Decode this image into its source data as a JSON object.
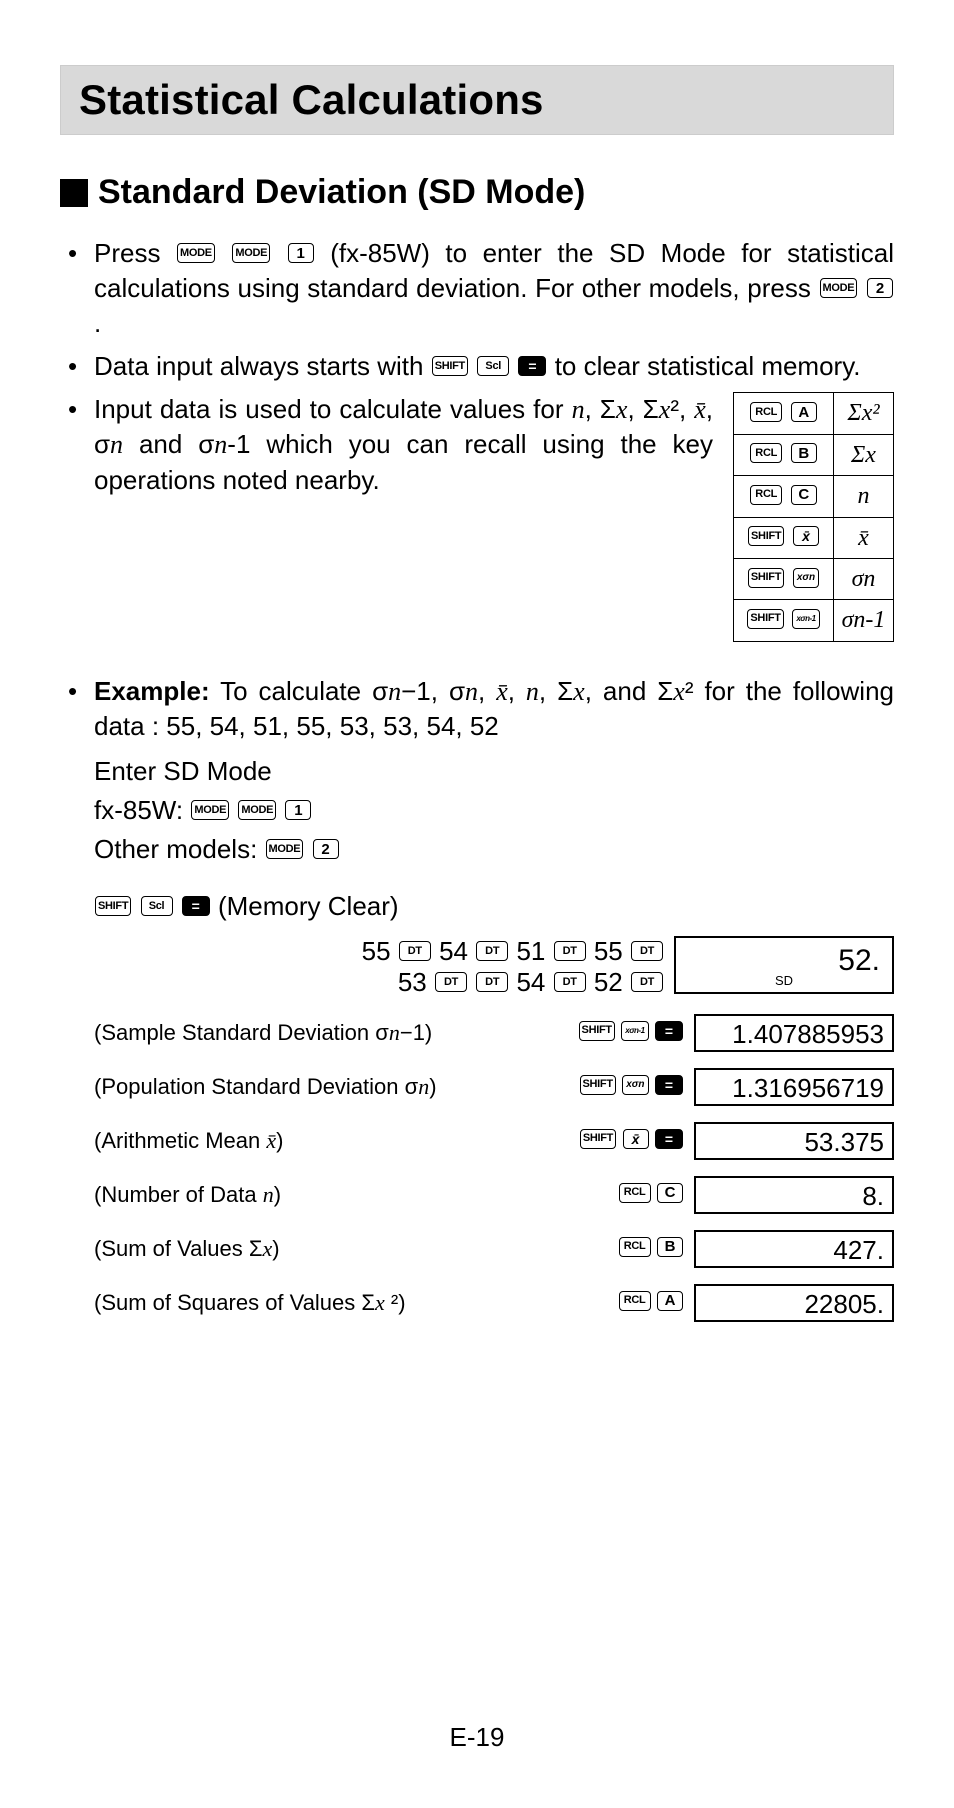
{
  "title": "Statistical Calculations",
  "section_heading": "Standard Deviation (SD Mode)",
  "bullets": {
    "b1_pre": "Press ",
    "b1_post_keys": " (fx-85W) to enter the SD Mode for statistical calculations using standard deviation. For other models, press ",
    "b1_end": ".",
    "b2_pre": "Data input always starts with ",
    "b2_post": " to clear statistical memory.",
    "b3": "Input data is used to calculate values for n, Σx, Σx², x̄, σn and σn-1 which you can recall using the key operations noted nearby."
  },
  "keys": {
    "mode": "MODE",
    "one": "1",
    "two": "2",
    "shift": "SHIFT",
    "scl": "Scl",
    "exe": "=",
    "rcl": "RCL",
    "A": "A",
    "B": "B",
    "C": "C",
    "DT": "DT"
  },
  "recall_table": [
    {
      "k1": "RCL",
      "k2": "A",
      "stat": "Σx²"
    },
    {
      "k1": "RCL",
      "k2": "B",
      "stat": "Σx"
    },
    {
      "k1": "RCL",
      "k2": "C",
      "stat": "n"
    },
    {
      "k1": "SHIFT",
      "k2": "x̄",
      "stat": "x̄"
    },
    {
      "k1": "SHIFT",
      "k2": "xσn",
      "stat": "σn"
    },
    {
      "k1": "SHIFT",
      "k2": "xσn-1",
      "stat": "σn-1"
    }
  ],
  "example": {
    "label": "Example:",
    "text_pre": " To calculate σn−1, σn, x̄, n, Σx, and Σx² for the following data : 55, 54, 51, 55, 53, 53, 54, 52",
    "enter_sd": "Enter SD Mode",
    "fx85w": "fx-85W: ",
    "other": "Other models: ",
    "mem_clear": " (Memory Clear)",
    "data_line1_vals": [
      "55",
      "54",
      "51",
      "55"
    ],
    "data_line2_vals": [
      "53",
      "",
      "54",
      "52"
    ],
    "first_display": "52.",
    "sd_tag": "SD"
  },
  "results": [
    {
      "label": "(Sample Standard Deviation σn−1)",
      "keys": "SHIFT xσn-1 =",
      "value": "1.407885953"
    },
    {
      "label": "(Population Standard Deviation σn)",
      "keys": "SHIFT xσn =",
      "value": "1.316956719"
    },
    {
      "label": "(Arithmetic Mean x̄)",
      "keys": "SHIFT x̄ =",
      "value": "53.375"
    },
    {
      "label": "(Number of Data n)",
      "keys": "RCL C",
      "value": "8."
    },
    {
      "label": "(Sum of  Values Σx)",
      "keys": "RCL B",
      "value": "427."
    },
    {
      "label": "(Sum of Squares of Values Σx ²)",
      "keys": "RCL A",
      "value": "22805."
    }
  ],
  "page_num": "E-19"
}
